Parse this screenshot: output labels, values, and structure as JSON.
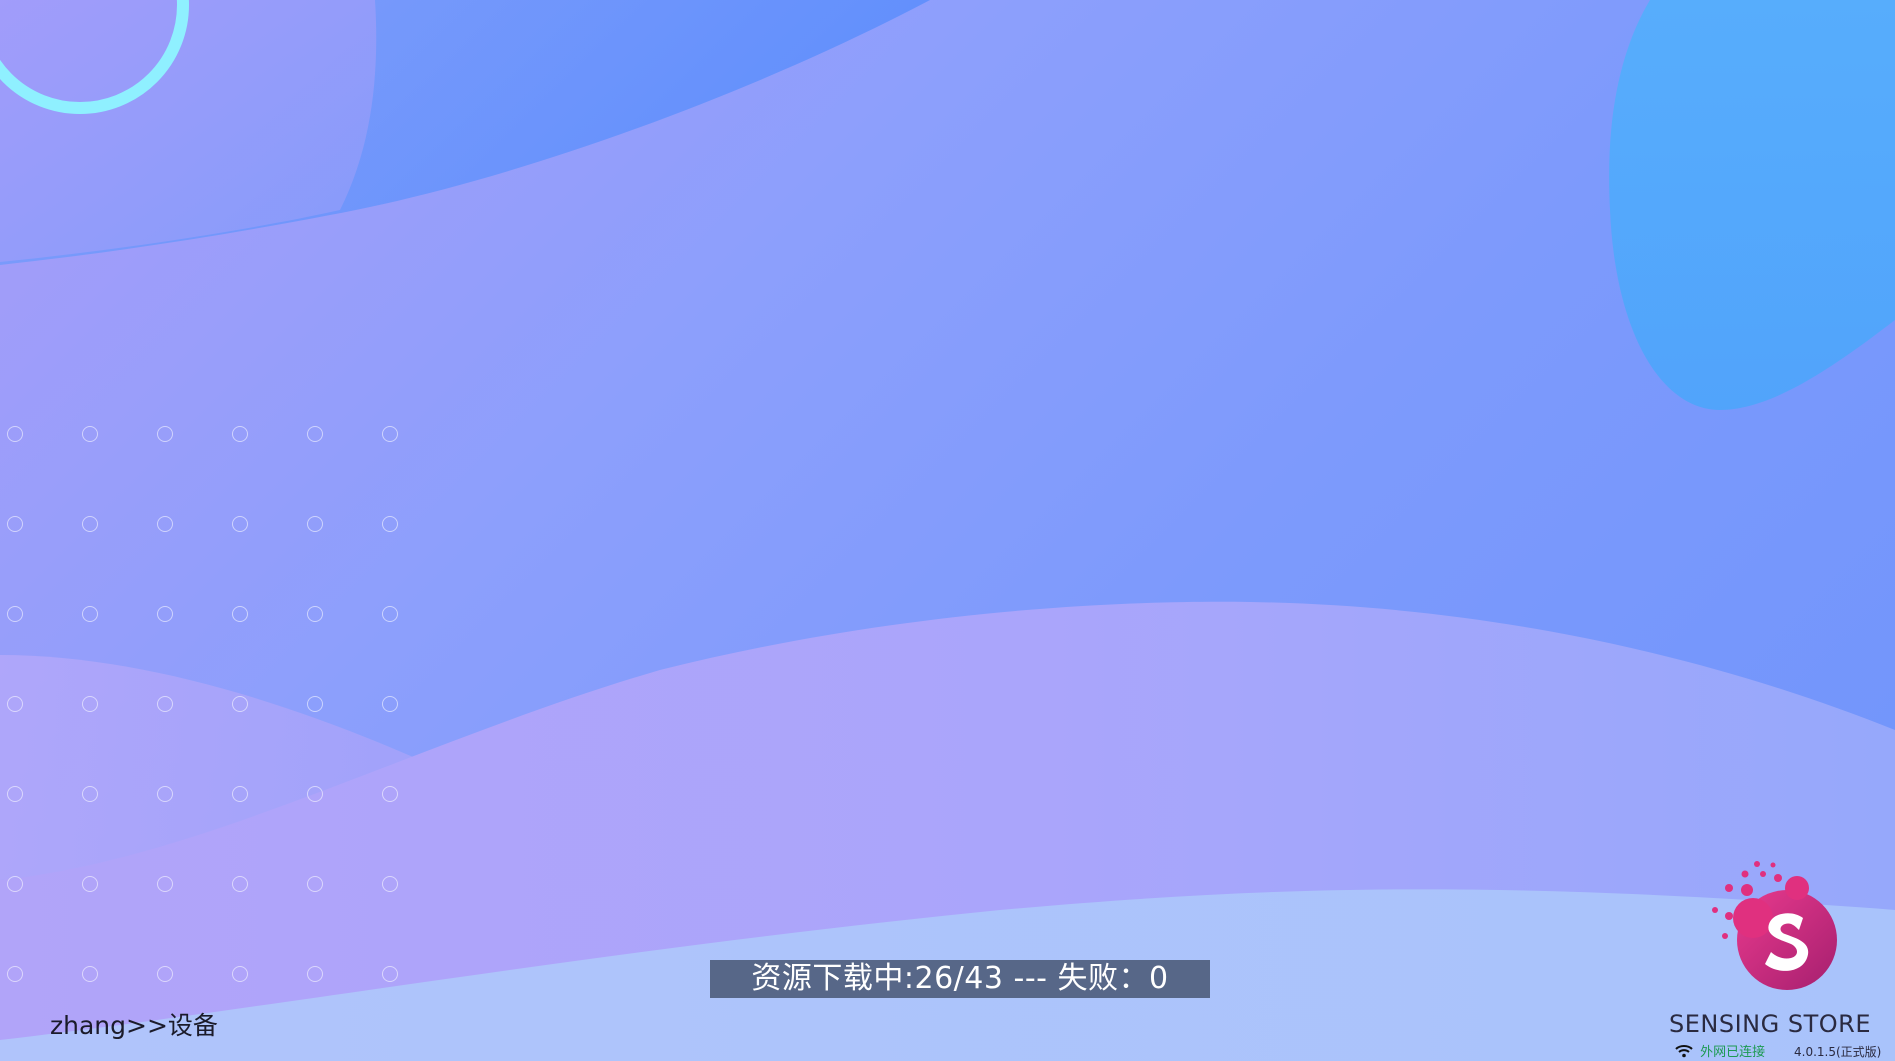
{
  "status": {
    "text": "资源下载中:26/43 --- 失败：0"
  },
  "breadcrumb": {
    "text": "zhang>>设备"
  },
  "brand": {
    "name": "SENSING STORE",
    "network_status": "外网已连接",
    "version": "4.0.1.5(正式版)",
    "logo_icon": "sensing-store-s-logo-icon",
    "wifi_icon": "wifi-icon"
  },
  "colors": {
    "status_bar_bg": "#4b5a78",
    "network_status": "#1d9a52",
    "logo_pink": "#e0307f",
    "ring_cyan": "#8ff0ff"
  }
}
